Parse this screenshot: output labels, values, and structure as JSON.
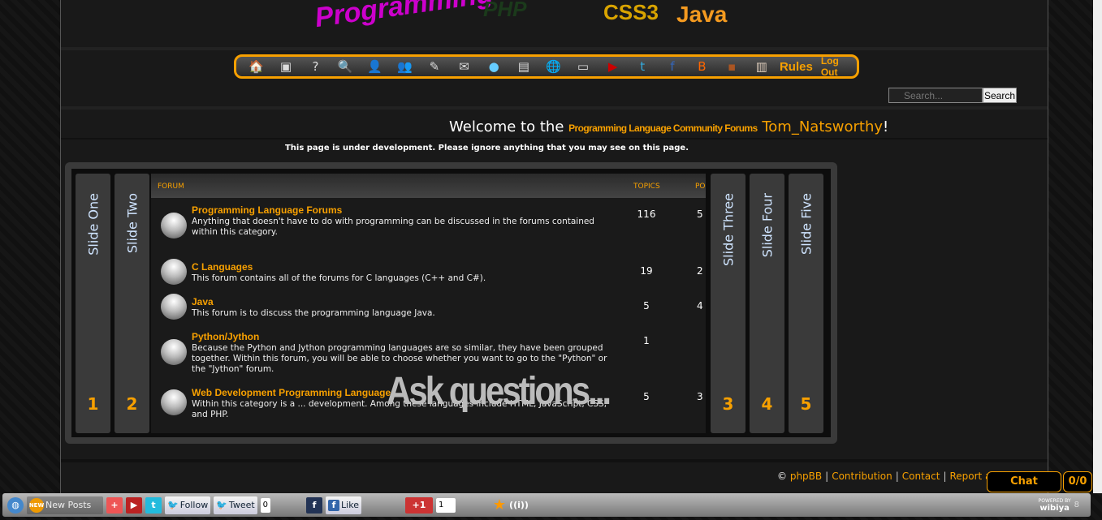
{
  "header": {
    "logo_words": [
      "Programming",
      "PHP",
      "CSS3",
      "Java"
    ]
  },
  "nav": {
    "icons": [
      "home-icon",
      "calendar-icon",
      "help-icon",
      "search-icon",
      "profile-icon",
      "members-icon",
      "edit-icon",
      "mail-icon",
      "chat-bubble-icon",
      "database-icon",
      "globe-icon",
      "news-icon",
      "youtube-icon",
      "twitter-icon",
      "facebook-icon",
      "blogger-icon",
      "tv-icon",
      "blocks-icon"
    ],
    "rules": "Rules",
    "logout": "Log Out"
  },
  "search": {
    "placeholder": "Search...",
    "button": "Search"
  },
  "welcome": {
    "prefix": "Welcome to the",
    "brand": "Programming Language Community Forums",
    "user": "Tom_Natsworthy",
    "suffix": "!"
  },
  "notice": "This page is under development. Please ignore anything that you may see on this page.",
  "slider": {
    "tabs": [
      {
        "label": "Slide One",
        "num": "1"
      },
      {
        "label": "Slide Two",
        "num": "2"
      },
      {
        "label": "Slide Three",
        "num": "3"
      },
      {
        "label": "Slide Four",
        "num": "4"
      },
      {
        "label": "Slide Five",
        "num": "5"
      }
    ],
    "overlay": "Ask questions..."
  },
  "forum": {
    "headers": {
      "forum": "FORUM",
      "topics": "TOPICS",
      "posts": "PO"
    },
    "rows": [
      {
        "title": "Programming Language Forums",
        "desc": "Anything that doesn't have to do with programming can be discussed in the forums contained within this category.",
        "topics": "116",
        "posts": "5"
      },
      {
        "title": "C Languages",
        "desc": "This forum contains all of the forums for C languages (C++ and C#).",
        "topics": "19",
        "posts": "2"
      },
      {
        "title": "Java",
        "desc": "This forum is to discuss the programming language Java.",
        "topics": "5",
        "posts": "4"
      },
      {
        "title": "Python/Jython",
        "desc": "Because the Python and Jython programming languages are so similar, they have been grouped together. Within this forum, you will be able to choose whether you want to go to the \"Python\" or the \"Jython\" forum.",
        "topics": "1",
        "posts": ""
      },
      {
        "title": "Web Development Programming Languages",
        "desc": "Within this category is a ... development. Among these languages include HTML, JavaScript, CSS, and PHP.",
        "topics": "5",
        "posts": "3"
      }
    ]
  },
  "footer": {
    "copyright": "©",
    "links": [
      "phpBB",
      "Contribution",
      "Contact",
      "Report an"
    ]
  },
  "chat": {
    "label": "Chat",
    "count": "0/0"
  },
  "toolbar": {
    "new_posts": "New Posts",
    "follow": "Follow",
    "tweet": "Tweet",
    "tweet_count": "0",
    "like": "Like",
    "gplus": "+1",
    "gplus_count": "1",
    "powered": "POWERED BY",
    "brand": "wibiya",
    "count": "8"
  }
}
